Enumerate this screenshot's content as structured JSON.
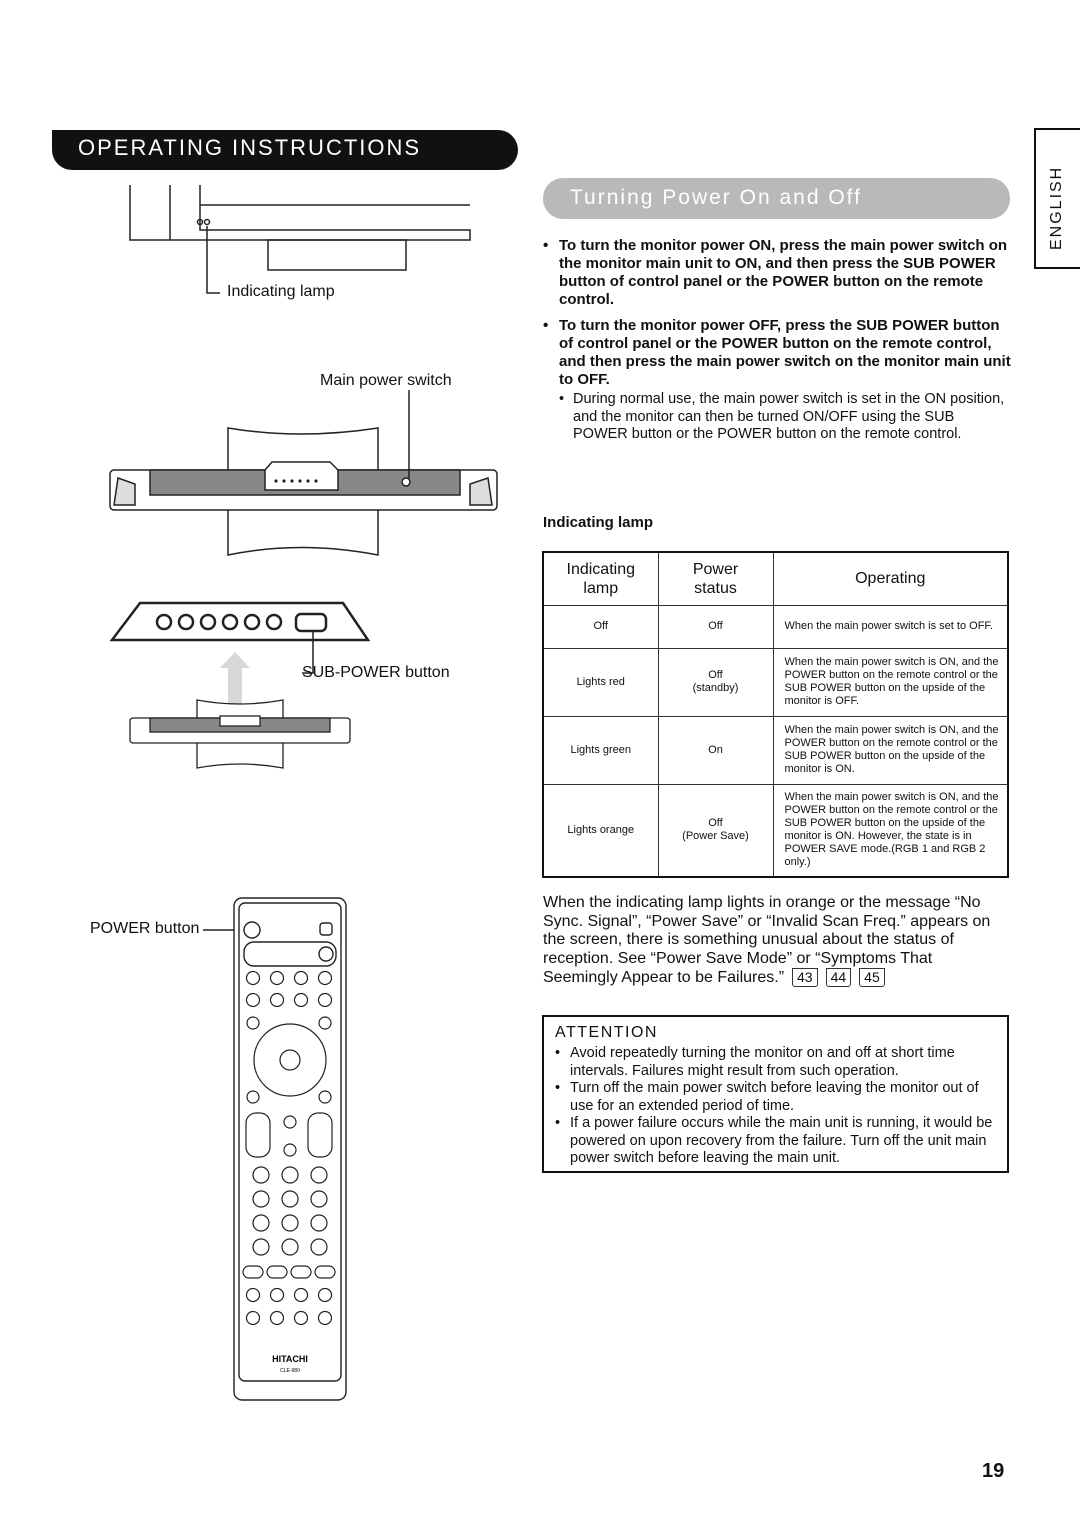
{
  "header": {
    "title": "OPERATING INSTRUCTIONS",
    "language_tab": "ENGLISH"
  },
  "section": {
    "title": "Turning Power On and Off"
  },
  "instructions": [
    "To turn the monitor power ON, press the main power switch on the monitor main unit to ON, and then press the SUB POWER button of control panel or the POWER button on the remote control.",
    "To turn the monitor power OFF, press the SUB POWER button of control panel or the POWER button on the remote control, and then press the main power switch on the monitor main unit to OFF."
  ],
  "note": "During normal use, the main power switch is set in the ON position, and the monitor can then be turned ON/OFF using the SUB POWER button or the POWER button on the remote control.",
  "lamp_section": {
    "heading": "Indicating lamp",
    "columns": [
      "Indicating lamp",
      "Power status",
      "Operating"
    ],
    "rows": [
      {
        "lamp": "Off",
        "status": "Off",
        "status2": "",
        "operating": "When the main power switch is set to OFF."
      },
      {
        "lamp": "Lights red",
        "status": "Off",
        "status2": "(standby)",
        "operating": "When the main power switch is ON, and the POWER button on the remote control or the SUB POWER button on the upside of the monitor is OFF."
      },
      {
        "lamp": "Lights green",
        "status": "On",
        "status2": "",
        "operating": "When the main power switch is ON, and the POWER button on the remote control or the SUB POWER button on the upside of the monitor is ON."
      },
      {
        "lamp": "Lights orange",
        "status": "Off",
        "status2": "(Power Save)",
        "operating": "When the main power switch is ON, and the POWER button on the remote control or the SUB POWER button on the upside of the monitor is ON. However, the state is in POWER SAVE mode.(RGB 1 and RGB 2 only.)"
      }
    ]
  },
  "paragraph": "When the indicating lamp lights in orange or the message “No Sync. Signal”, “Power Save” or “Invalid Scan Freq.” appears on the screen, there is something unusual about the status of reception. See “Power Save Mode” or “Symptoms That Seemingly Appear to be Failures.”",
  "page_refs": [
    "43",
    "44",
    "45"
  ],
  "attention": {
    "title": "ATTENTION",
    "items": [
      "Avoid repeatedly turning the monitor on and off at short time intervals. Failures might result from such operation.",
      "Turn off the main power switch before leaving the monitor out of use for an extended period of time.",
      "If a power failure occurs while the main unit is running, it would be powered on upon recovery from the failure. Turn off the unit main power switch before leaving the main unit."
    ]
  },
  "illustration_labels": {
    "indicating_lamp": "Indicating lamp",
    "main_power_switch": "Main power switch",
    "sub_power_button": "SUB-POWER button",
    "power_button": "POWER button",
    "remote_brand": "HITACHI",
    "remote_model": "CLE-980"
  },
  "page_number": "19",
  "colors": {
    "header_bg": "#111111",
    "section_pill": "#b9b9b9"
  }
}
